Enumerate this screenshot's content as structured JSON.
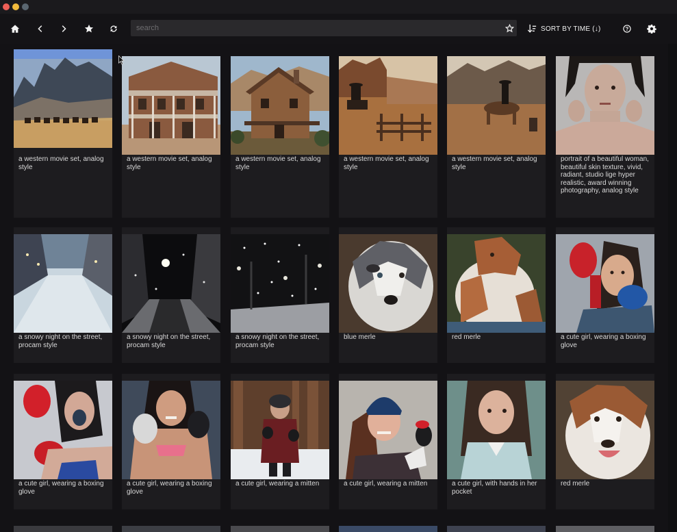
{
  "toolbar": {
    "home_icon": "home-icon",
    "back_icon": "chevron-left-icon",
    "forward_icon": "chevron-right-icon",
    "favorites_icon": "star-icon",
    "refresh_icon": "refresh-icon",
    "search_placeholder": "search",
    "search_value": "",
    "sort_label": "SORT BY TIME (↓)",
    "help_icon": "help-icon",
    "settings_icon": "gear-icon"
  },
  "colors": {
    "background": "#131215",
    "card": "#1d1c1f",
    "search_bg": "#2a292c",
    "text": "#d9d9d9"
  },
  "images": [
    {
      "caption": "a western movie set, analog style",
      "scene": "desert-riders"
    },
    {
      "caption": "a western movie set, analog style",
      "scene": "saloon"
    },
    {
      "caption": "a western movie set, analog style",
      "scene": "cabin"
    },
    {
      "caption": "a western movie set, analog style",
      "scene": "cowboy-fence"
    },
    {
      "caption": "a western movie set, analog style",
      "scene": "cowboy-horse"
    },
    {
      "caption": "portrait of a beautiful woman, beautiful skin texture, vivid, radiant, studio lige hyper realistic, award winning photography, analog style",
      "scene": "portrait"
    },
    {
      "caption": "a snowy night on the street, procam style",
      "scene": "snow-street"
    },
    {
      "caption": "a snowy night on the street, procam style",
      "scene": "night-street"
    },
    {
      "caption": "a snowy night on the street, procam style",
      "scene": "snow-park"
    },
    {
      "caption": "blue merle",
      "scene": "blue-merle"
    },
    {
      "caption": "red merle",
      "scene": "red-merle"
    },
    {
      "caption": "a cute girl, wearing a boxing glove",
      "scene": "boxing-girl"
    },
    {
      "caption": "a cute girl, wearing a boxing glove",
      "scene": "boxing-girl-2"
    },
    {
      "caption": "a cute girl, wearing a boxing glove",
      "scene": "boxing-girl-3"
    },
    {
      "caption": "a cute girl, wearing a mitten",
      "scene": "mitten-forest"
    },
    {
      "caption": "a cute girl, wearing a mitten",
      "scene": "mitten-beanie"
    },
    {
      "caption": "a cute girl, with hands in her pocket",
      "scene": "girl-pocket"
    },
    {
      "caption": "red merle",
      "scene": "red-merle-2"
    }
  ]
}
